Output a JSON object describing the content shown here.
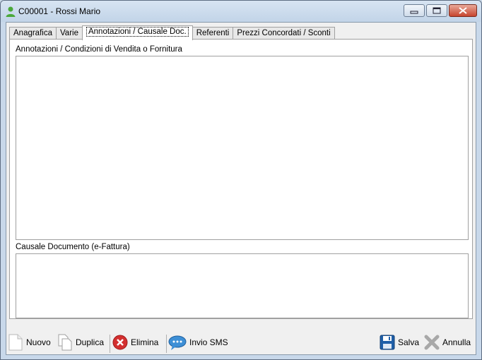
{
  "window": {
    "title": "C00001 - Rossi Mario",
    "controls": {
      "minimize": "▭",
      "maximize": "□",
      "close": "✕"
    }
  },
  "tabs": [
    {
      "label": "Anagrafica",
      "active": false
    },
    {
      "label": "Varie",
      "active": false
    },
    {
      "label": "Annotazioni / Causale Doc.",
      "active": true
    },
    {
      "label": "Referenti",
      "active": false
    },
    {
      "label": "Prezzi Concordati / Sconti",
      "active": false
    }
  ],
  "panel": {
    "notes_label": "Annotazioni / Condizioni di Vendita o Fornitura",
    "notes_value": "",
    "causale_label": "Causale Documento (e-Fattura)",
    "causale_value": ""
  },
  "toolbar": {
    "nuovo": "Nuovo",
    "duplica": "Duplica",
    "elimina": "Elimina",
    "invio_sms": "Invio SMS",
    "salva": "Salva",
    "annulla": "Annulla"
  },
  "colors": {
    "user_icon": "#4aa83a",
    "delete_icon": "#d32f2f",
    "sms_icon": "#3d8fd6",
    "save_icon": "#1f5fa8",
    "cancel_icon": "#9a9a9a"
  }
}
